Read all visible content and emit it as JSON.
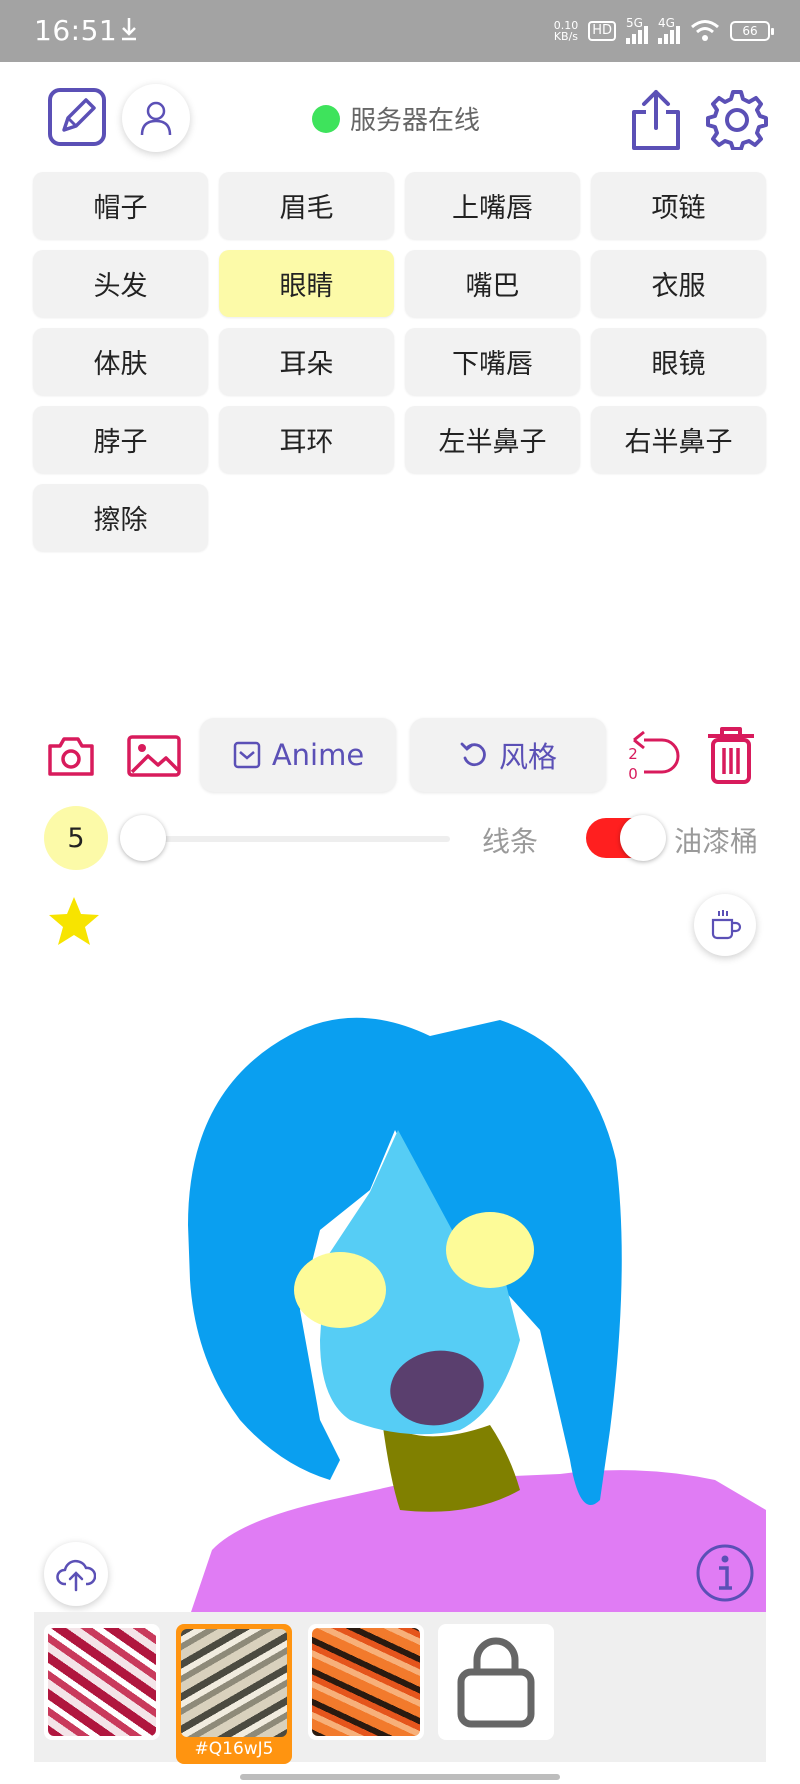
{
  "status_bar": {
    "time": "16:51",
    "net_speed_value": "0.10",
    "net_speed_unit": "KB/s",
    "hd_label": "HD",
    "sim1_label": "5G",
    "sim2_label": "4G",
    "battery": "66"
  },
  "header": {
    "server_status": "服务器在线",
    "server_status_color": "#3ee35c"
  },
  "parts": [
    {
      "label": "帽子",
      "selected": false
    },
    {
      "label": "眉毛",
      "selected": false
    },
    {
      "label": "上嘴唇",
      "selected": false
    },
    {
      "label": "项链",
      "selected": false
    },
    {
      "label": "头发",
      "selected": false
    },
    {
      "label": "眼睛",
      "selected": true
    },
    {
      "label": "嘴巴",
      "selected": false
    },
    {
      "label": "衣服",
      "selected": false
    },
    {
      "label": "体肤",
      "selected": false
    },
    {
      "label": "耳朵",
      "selected": false
    },
    {
      "label": "下嘴唇",
      "selected": false
    },
    {
      "label": "眼镜",
      "selected": false
    },
    {
      "label": "脖子",
      "selected": false
    },
    {
      "label": "耳环",
      "selected": false
    },
    {
      "label": "左半鼻子",
      "selected": false
    },
    {
      "label": "右半鼻子",
      "selected": false
    },
    {
      "label": "擦除",
      "selected": false
    }
  ],
  "toolbar": {
    "model_label": "Anime",
    "style_label": "风格",
    "undo_count_top": "2",
    "undo_count_bottom": "0",
    "accent_color": "#d81b5c",
    "primary_color": "#5b50b6"
  },
  "brush": {
    "size": "5",
    "line_label": "线条",
    "bucket_label": "油漆桶",
    "bucket_enabled": true
  },
  "styles": {
    "selected_code": "#Q16wJ5",
    "selected_color": "#ff9410"
  }
}
